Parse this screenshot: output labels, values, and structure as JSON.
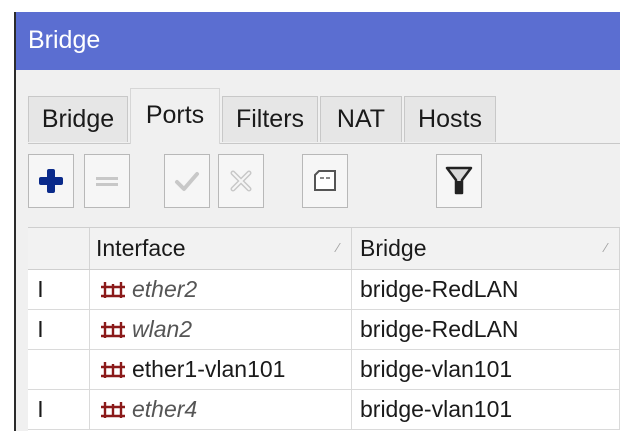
{
  "window": {
    "title": "Bridge"
  },
  "tabs": [
    {
      "label": "Bridge",
      "active": false
    },
    {
      "label": "Ports",
      "active": true
    },
    {
      "label": "Filters",
      "active": false
    },
    {
      "label": "NAT",
      "active": false
    },
    {
      "label": "Hosts",
      "active": false
    }
  ],
  "toolbar": {
    "buttons": [
      {
        "icon": "add-icon",
        "enabled": true
      },
      {
        "icon": "remove-icon",
        "enabled": false
      },
      {
        "icon": "enable-icon",
        "enabled": false
      },
      {
        "icon": "disable-icon",
        "enabled": false
      },
      {
        "icon": "comment-icon",
        "enabled": true
      },
      {
        "icon": "filter-icon",
        "enabled": true
      }
    ]
  },
  "table": {
    "columns": [
      "Interface",
      "Bridge"
    ],
    "rows": [
      {
        "flag": "I",
        "interface": "ether2",
        "bridge": "bridge-RedLAN",
        "inactive": true
      },
      {
        "flag": "I",
        "interface": "wlan2",
        "bridge": "bridge-RedLAN",
        "inactive": true
      },
      {
        "flag": "",
        "interface": "ether1-vlan101",
        "bridge": "bridge-vlan101",
        "inactive": false
      },
      {
        "flag": "I",
        "interface": "ether4",
        "bridge": "bridge-vlan101",
        "inactive": true
      }
    ]
  },
  "colors": {
    "titlebar": "#5b6ed1",
    "accent_add": "#0a2a8a",
    "port_icon": "#8b1a1a"
  }
}
